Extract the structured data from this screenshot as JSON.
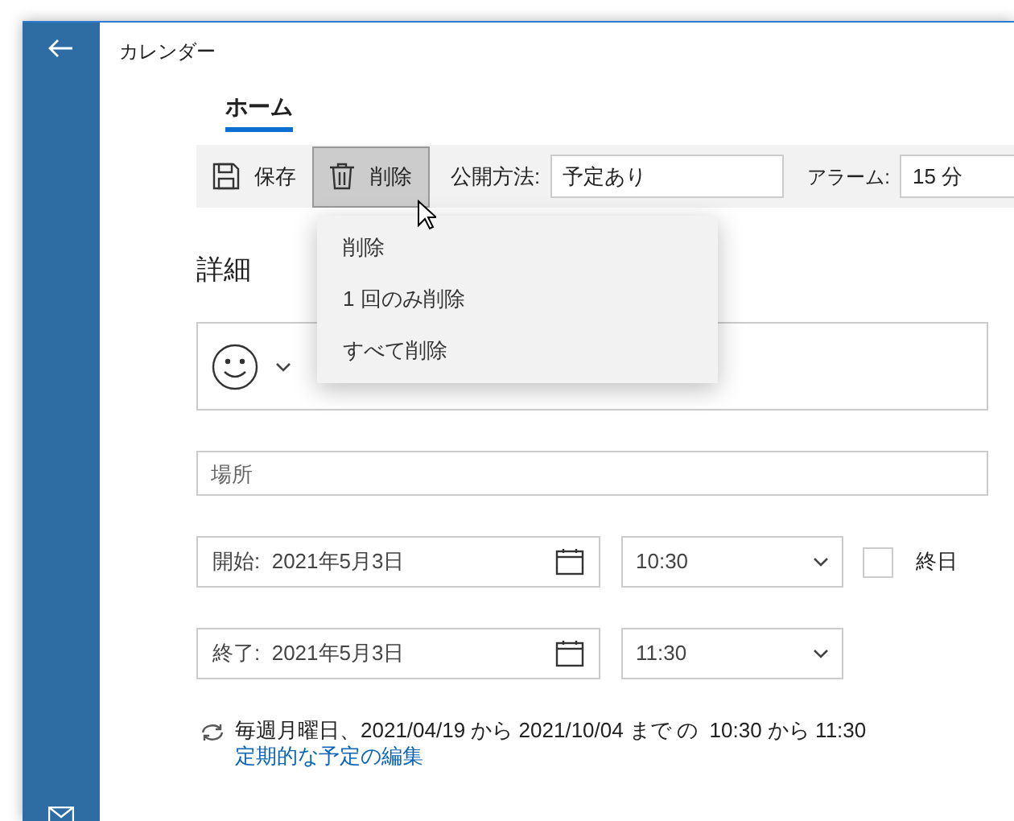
{
  "window": {
    "title": "カレンダー"
  },
  "tabs": [
    {
      "label": "ホーム",
      "selected": true
    }
  ],
  "toolbar": {
    "save": "保存",
    "delete": {
      "label": "削除",
      "pressed": true
    },
    "visibility_label": "公開方法:",
    "visibility_value": "予定あり",
    "alarm_label": "アラーム:",
    "alarm_value": "15 分"
  },
  "delete_menu": [
    "削除",
    "1 回のみ削除",
    "すべて削除"
  ],
  "section_title": "詳細",
  "location": {
    "placeholder": "場所"
  },
  "start": {
    "date": "開始:  2021年5月3日",
    "time": "10:30"
  },
  "end": {
    "date": "終了:  2021年5月3日",
    "time": "11:30"
  },
  "all_day": {
    "label": "終日",
    "checked": false
  },
  "recurrence": {
    "text": "毎週月曜日、2021/04/19 から 2021/10/04 まで の  10:30 から 11:30",
    "link": "定期的な予定の編集"
  }
}
